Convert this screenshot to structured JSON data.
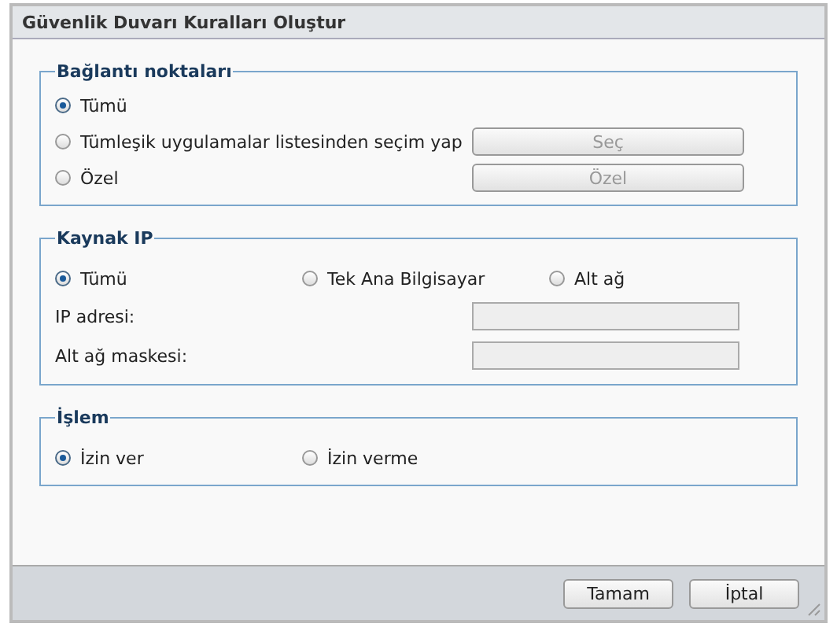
{
  "window": {
    "title": "Güvenlik Duvarı Kuralları Oluştur"
  },
  "ports": {
    "legend": "Bağlantı noktaları",
    "options": [
      {
        "label": "Tümü",
        "selected": true
      },
      {
        "label": "Tümleşik uygulamalar listesinden seçim yap",
        "selected": false,
        "button": {
          "label": "Seç",
          "disabled": true
        }
      },
      {
        "label": "Özel",
        "selected": false,
        "button": {
          "label": "Özel",
          "disabled": true
        }
      }
    ]
  },
  "source_ip": {
    "legend": "Kaynak IP",
    "options": [
      {
        "label": "Tümü",
        "selected": true
      },
      {
        "label": "Tek Ana Bilgisayar",
        "selected": false
      },
      {
        "label": "Alt ağ",
        "selected": false
      }
    ],
    "fields": [
      {
        "label": "IP adresi:",
        "disabled": true
      },
      {
        "label": "Alt ağ maskesi:",
        "disabled": true
      }
    ]
  },
  "action": {
    "legend": "İşlem",
    "options": [
      {
        "label": "İzin ver",
        "selected": true
      },
      {
        "label": "İzin verme",
        "selected": false
      }
    ]
  },
  "buttons": [
    {
      "label": "Tamam"
    },
    {
      "label": "İptal"
    }
  ]
}
